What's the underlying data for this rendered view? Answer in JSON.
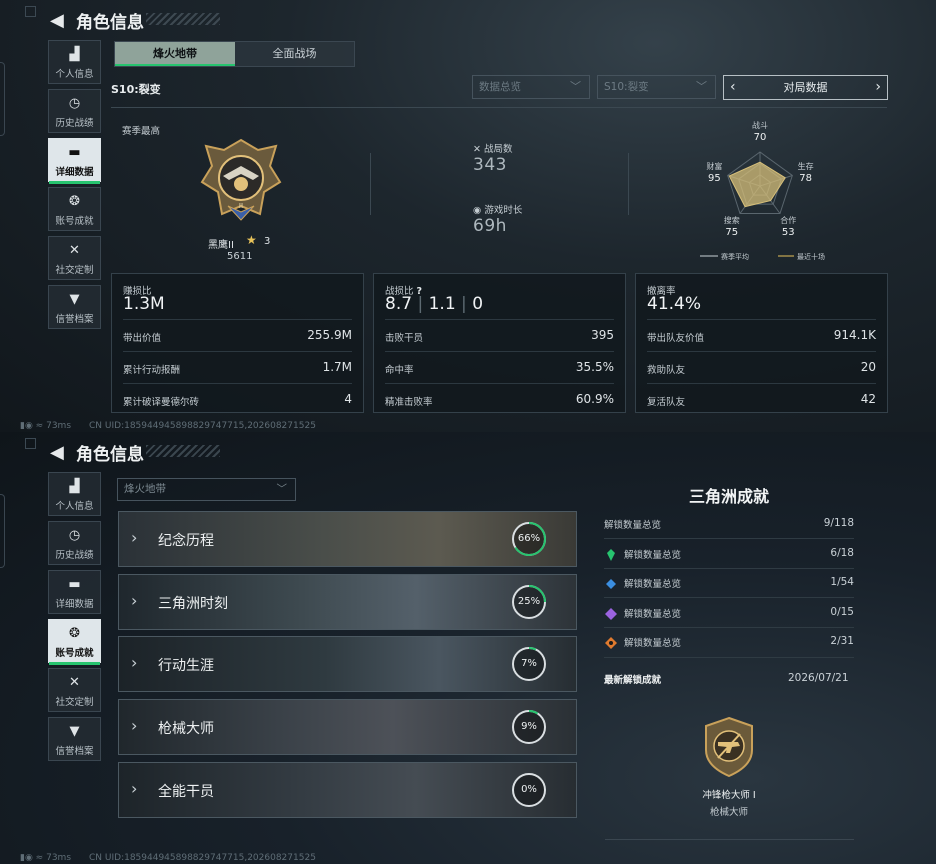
{
  "header": {
    "title": "角色信息",
    "back_icon": "chevron-left-icon"
  },
  "sidebar": {
    "items": [
      {
        "label": "个人信息",
        "icon": "bar-chart-icon"
      },
      {
        "label": "历史战绩",
        "icon": "clock-icon"
      },
      {
        "label": "详细数据",
        "icon": "folder-icon"
      },
      {
        "label": "账号成就",
        "icon": "medal-icon"
      },
      {
        "label": "社交定制",
        "icon": "tools-icon"
      },
      {
        "label": "信誉档案",
        "icon": "shield-icon"
      }
    ]
  },
  "panel1": {
    "active_nav": 2,
    "tabs": [
      "烽火地带",
      "全面战场"
    ],
    "season": "S10:裂变",
    "dropdown_overview": "数据总览",
    "dropdown_season": "S10:裂变",
    "pager_label": "对局数据",
    "season_high_label": "赛季最高",
    "rank": {
      "name": "黑鹰II",
      "stars": "3",
      "points": "5611"
    },
    "matches": {
      "label": "战局数",
      "value": "343"
    },
    "playtime": {
      "label": "游戏时长",
      "value": "69h"
    },
    "radar": {
      "axes": [
        {
          "label": "战斗",
          "value": "70"
        },
        {
          "label": "生存",
          "value": "78"
        },
        {
          "label": "合作",
          "value": "53"
        },
        {
          "label": "搜索",
          "value": "75"
        },
        {
          "label": "财富",
          "value": "95"
        }
      ],
      "legend_avg": "赛季平均",
      "legend_recent": "最近十场"
    },
    "cards": [
      {
        "big_label": "赚损比",
        "big_value": "1.3M",
        "rows": [
          {
            "k": "带出价值",
            "v": "255.9M"
          },
          {
            "k": "累计行动报酬",
            "v": "1.7M"
          },
          {
            "k": "累计破译曼德尔砖",
            "v": "4"
          }
        ]
      },
      {
        "big_label": "战损比",
        "big_value_a": "8.7",
        "big_value_b": "1.1",
        "big_value_c": "0",
        "help": "?",
        "rows": [
          {
            "k": "击败干员",
            "v": "395"
          },
          {
            "k": "命中率",
            "v": "35.5%"
          },
          {
            "k": "精准击败率",
            "v": "60.9%"
          }
        ]
      },
      {
        "big_label": "撤离率",
        "big_value": "41.4%",
        "rows": [
          {
            "k": "带出队友价值",
            "v": "914.1K"
          },
          {
            "k": "救助队友",
            "v": "20"
          },
          {
            "k": "复活队友",
            "v": "42"
          }
        ]
      }
    ],
    "footer": {
      "ping": "73ms",
      "uid": "CN UID:18594494589882974771​5,202608271525"
    }
  },
  "panel2": {
    "active_nav": 3,
    "dropdown": "烽火地带",
    "achievements": [
      {
        "name": "纪念历程",
        "percent": "66%",
        "progress": 0.66
      },
      {
        "name": "三角洲时刻",
        "percent": "25%",
        "progress": 0.25
      },
      {
        "name": "行动生涯",
        "percent": "7%",
        "progress": 0.07
      },
      {
        "name": "枪械大师",
        "percent": "9%",
        "progress": 0.09
      },
      {
        "name": "全能干员",
        "percent": "0%",
        "progress": 0
      }
    ],
    "summary": {
      "title": "三角洲成就",
      "total": {
        "k": "解锁数量总览",
        "v": "9/118"
      },
      "tiers": [
        {
          "k": "解锁数量总览",
          "v": "6/18",
          "color": "#27c46f"
        },
        {
          "k": "解锁数量总览",
          "v": "1/54",
          "color": "#3b8ee0"
        },
        {
          "k": "解锁数量总览",
          "v": "0/15",
          "color": "#9b63e0"
        },
        {
          "k": "解锁数量总览",
          "v": "2/31",
          "color": "#e07a2e"
        }
      ],
      "latest_label": "最新解锁成就",
      "latest_date": "2026/07/21",
      "badge_name": "冲锋枪大师 I",
      "badge_sub": "枪械大师"
    },
    "footer": {
      "ping": "73ms",
      "uid": "CN UID:18594494589882974771​5,202608271525"
    }
  },
  "colors": {
    "accent": "#27c46f",
    "gold": "#e8c35a"
  }
}
